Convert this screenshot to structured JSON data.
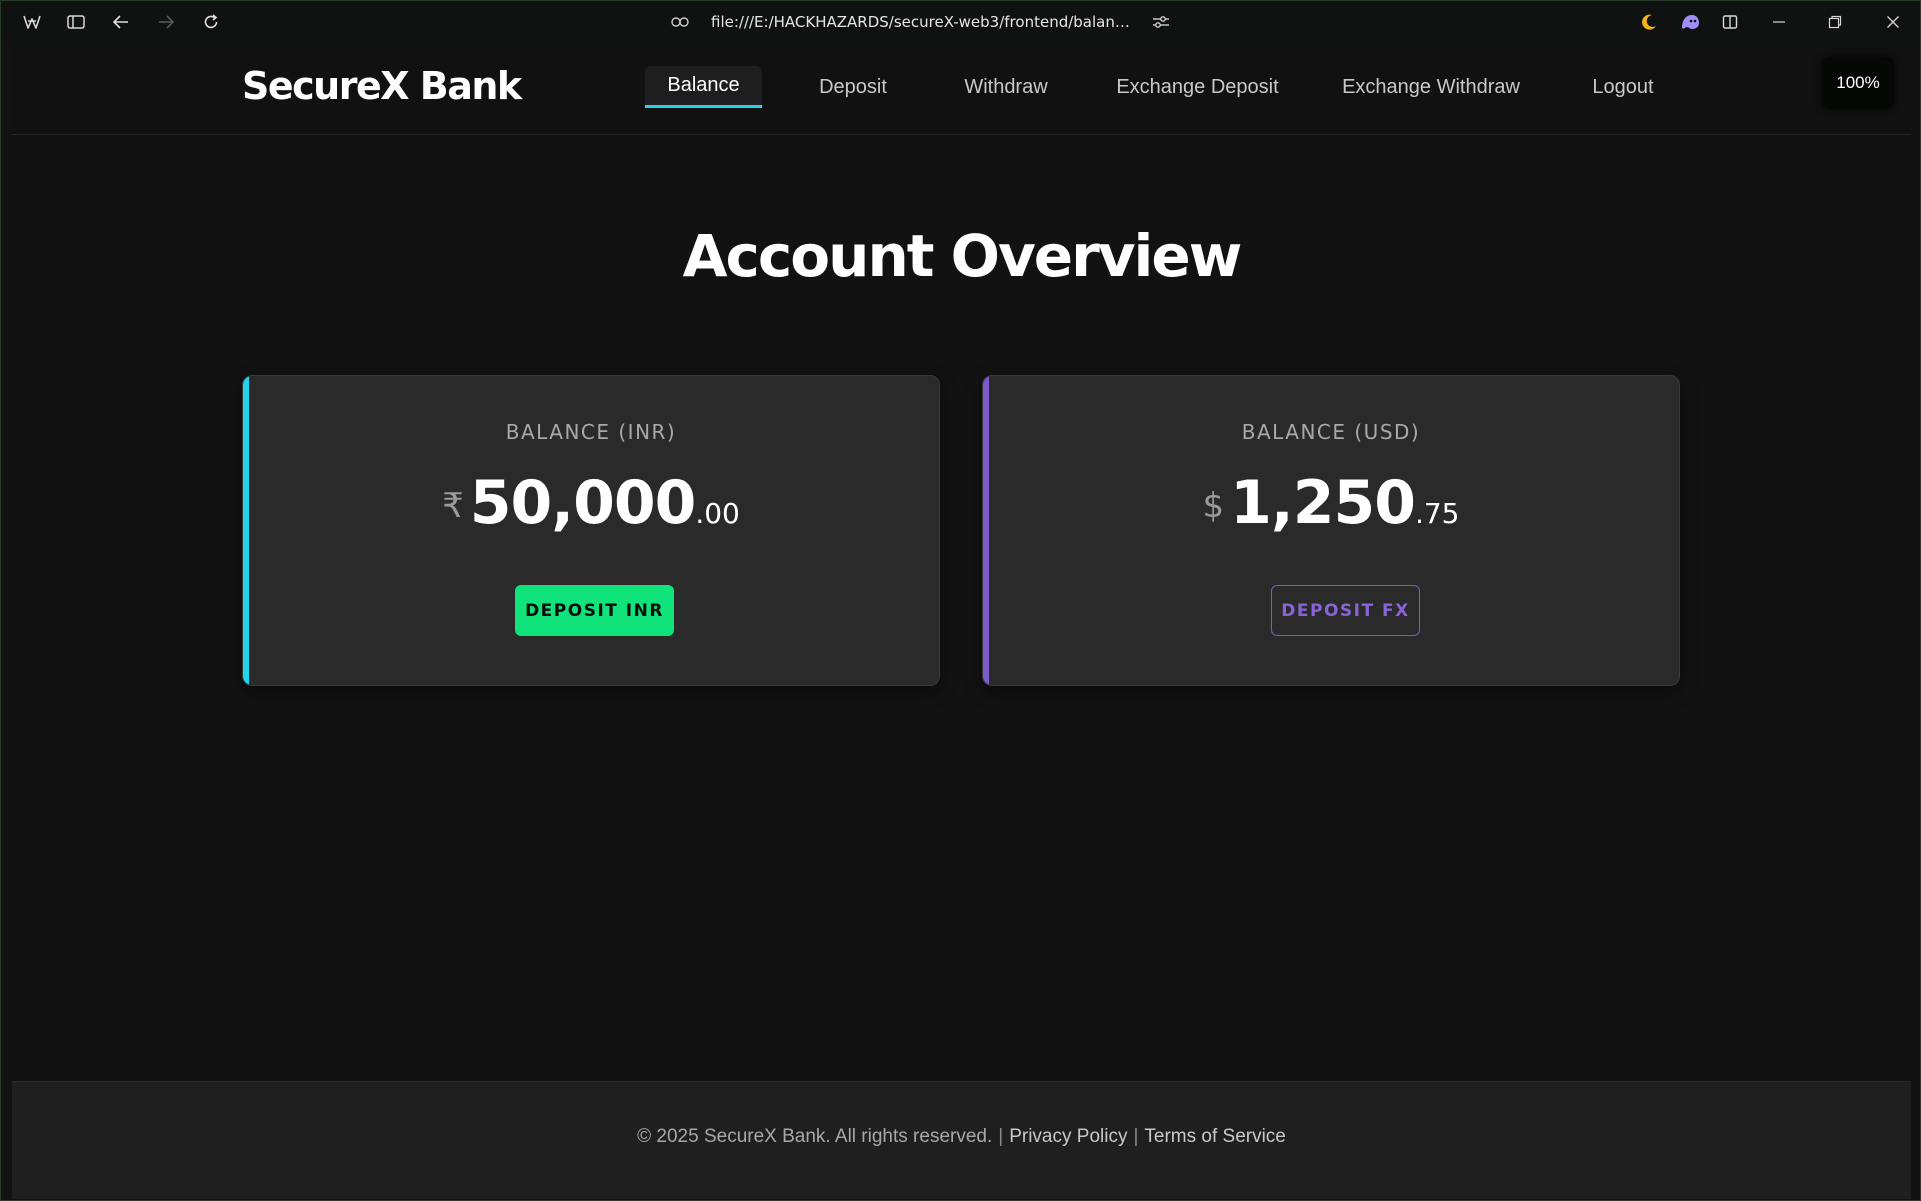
{
  "browser": {
    "url": "file:///E:/HACKHAZARDS/secureX-web3/frontend/balance.htm...",
    "icons": {
      "app": "browser-logo-icon",
      "sidebar": "sidebar-toggle-icon",
      "back": "back-arrow-icon",
      "forward": "forward-arrow-icon",
      "reload": "reload-icon",
      "link": "link-icon",
      "site_settings": "sliders-icon",
      "dark_mode": "moon-icon",
      "extension": "ghost-extension-icon",
      "split": "split-view-icon",
      "minimize": "minimize-icon",
      "restore": "restore-icon",
      "close": "close-icon"
    }
  },
  "navbar": {
    "brand": "SecureX Bank",
    "items": [
      {
        "label": "Balance",
        "active": true
      },
      {
        "label": "Deposit",
        "active": false
      },
      {
        "label": "Withdraw",
        "active": false
      },
      {
        "label": "Exchange Deposit",
        "active": false
      },
      {
        "label": "Exchange Withdraw",
        "active": false
      },
      {
        "label": "Logout",
        "active": false
      }
    ],
    "zoom": "100%"
  },
  "main": {
    "title": "Account Overview",
    "cards": [
      {
        "label": "BALANCE (INR)",
        "currency_symbol": "₹",
        "amount_whole": "50,000",
        "amount_decimal": ".00",
        "button_label": "DEPOSIT INR",
        "accent_color": "#22d3ee"
      },
      {
        "label": "BALANCE (USD)",
        "currency_symbol": "$",
        "amount_whole": "1,250",
        "amount_decimal": ".75",
        "button_label": "DEPOSIT FX",
        "accent_color": "#7b5bc9"
      }
    ]
  },
  "footer": {
    "copyright": "© 2025 SecureX Bank. All rights reserved.",
    "separator": "|",
    "links": [
      "Privacy Policy",
      "Terms of Service"
    ]
  },
  "colors": {
    "background": "#121212",
    "primary_accent": "#22d3ee",
    "secondary_accent": "#7b5bc9",
    "deposit_button": "#10e37a"
  }
}
